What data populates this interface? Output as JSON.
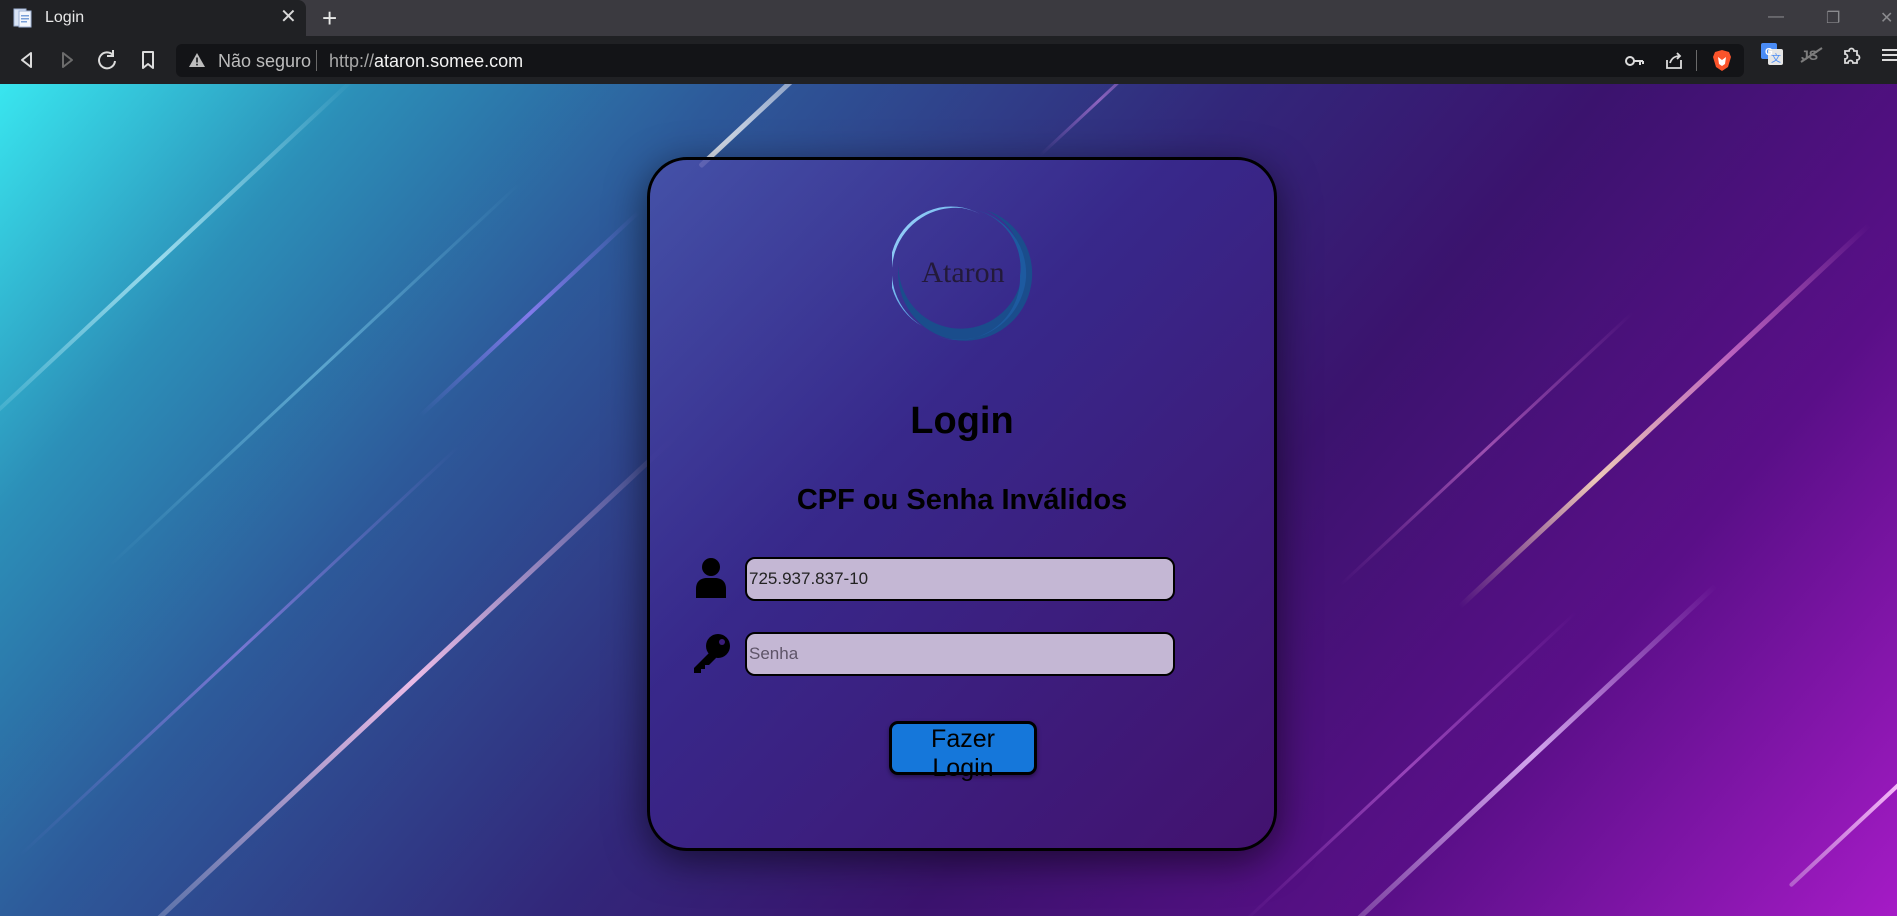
{
  "browser": {
    "tab": {
      "title": "Login"
    },
    "address": {
      "security_label": "Não seguro",
      "scheme": "http://",
      "host": "ataron.somee.com"
    }
  },
  "login": {
    "logo_text": "Ataron",
    "title": "Login",
    "error_message": "CPF ou Senha Inválidos",
    "cpf_value": "725.937.837-10",
    "password_placeholder": "Senha",
    "submit_label": "Fazer Login"
  },
  "colors": {
    "button": "#1577da",
    "input_bg": "#c4b7d4",
    "logo_ring_light": "#8ecaf5",
    "logo_ring_dark": "#1a4d8c"
  },
  "icons": [
    "file-icon",
    "close-icon",
    "plus-icon",
    "back-icon",
    "forward-icon",
    "reload-icon",
    "bookmark-icon",
    "warning-icon",
    "key-icon",
    "share-icon",
    "brave-shield-icon",
    "translate-icon",
    "extension-icon",
    "menu-icon",
    "user-icon",
    "password-key-icon"
  ]
}
